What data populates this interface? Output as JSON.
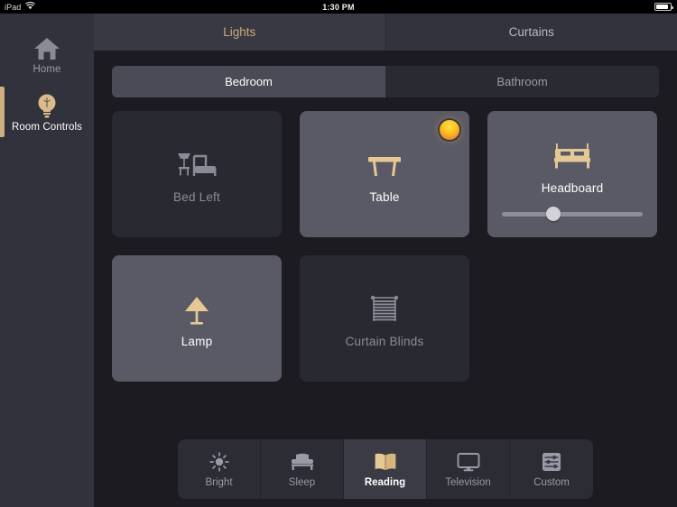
{
  "statusbar": {
    "device": "iPad",
    "wifi_icon": "wifi-icon",
    "time": "1:30 PM",
    "battery_icon": "battery-icon"
  },
  "sidebar": {
    "items": [
      {
        "label": "Home",
        "icon": "house-icon",
        "active": false
      },
      {
        "label": "Room Controls",
        "icon": "lightbulb-icon",
        "active": true
      }
    ]
  },
  "tabs": [
    {
      "label": "Lights",
      "active": true
    },
    {
      "label": "Curtains",
      "active": false
    }
  ],
  "rooms": [
    {
      "label": "Bedroom",
      "active": true
    },
    {
      "label": "Bathroom",
      "active": false
    }
  ],
  "devices": [
    {
      "label": "Bed Left",
      "icon": "bedside-lamp-icon",
      "on": false,
      "indicator": false,
      "slider": null
    },
    {
      "label": "Table",
      "icon": "table-icon",
      "on": true,
      "indicator": true,
      "slider": null
    },
    {
      "label": "Headboard",
      "icon": "bed-icon",
      "on": true,
      "indicator": false,
      "slider": 35
    },
    {
      "label": "Lamp",
      "icon": "floor-lamp-icon",
      "on": true,
      "indicator": false,
      "slider": null
    },
    {
      "label": "Curtain Blinds",
      "icon": "blinds-icon",
      "on": false,
      "indicator": false,
      "slider": null
    }
  ],
  "scenes": [
    {
      "label": "Bright",
      "icon": "sun-icon",
      "active": false
    },
    {
      "label": "Sleep",
      "icon": "bed-icon",
      "active": false
    },
    {
      "label": "Reading",
      "icon": "book-icon",
      "active": true
    },
    {
      "label": "Television",
      "icon": "monitor-icon",
      "active": false
    },
    {
      "label": "Custom",
      "icon": "sliders-icon",
      "active": false
    }
  ],
  "colors": {
    "accent": "#cdab7b",
    "indicator": "#ffc21e",
    "sidebar_bg": "#32323c",
    "content_bg": "#1b1b21",
    "card_off": "#292931",
    "card_on": "#5a5a66"
  }
}
